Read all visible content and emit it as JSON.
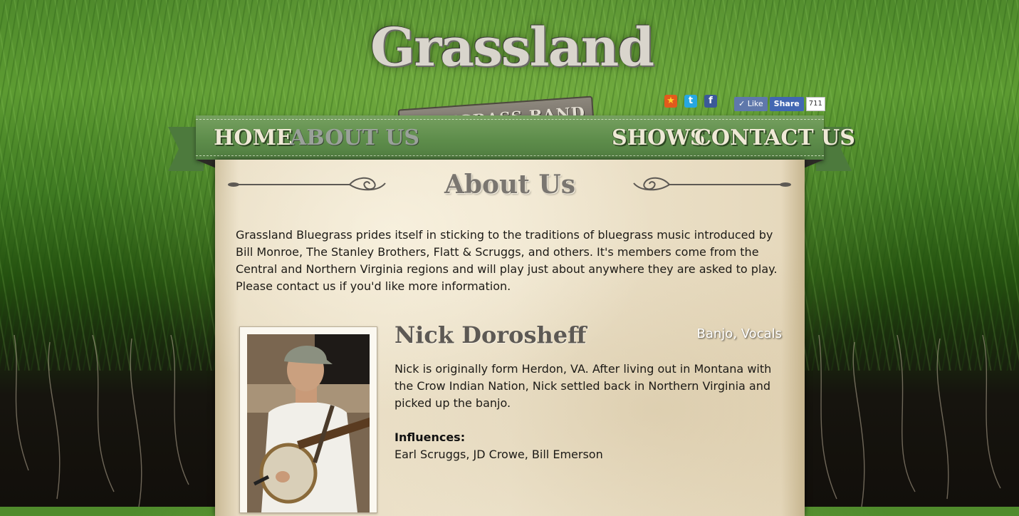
{
  "header": {
    "logo_title": "Grassland",
    "logo_subtitle": "BLUEGRASS BAND"
  },
  "social": {
    "icons": [
      "star-icon",
      "twitter-icon",
      "facebook-icon"
    ],
    "like_label": "Like",
    "share_label": "Share",
    "share_count": "711"
  },
  "nav": {
    "home": "HOME",
    "about": "ABOUT US",
    "shows": "SHOWS",
    "contact": "CONTACT US",
    "active": "about"
  },
  "page": {
    "title": "About Us",
    "intro": "Grassland Bluegrass prides itself in sticking to the traditions of bluegrass music introduced by Bill Monroe, The Stanley Brothers, Flatt & Scruggs, and others. It's members come from the Central and Northern Virginia regions and will play just about anywhere they are asked to play. Please contact us if you'd like more information."
  },
  "member": {
    "name": "Nick Dorosheff",
    "role": "Banjo, Vocals",
    "bio": "Nick is originally form Herdon, VA. After living out in Montana with the Crow Indian Nation, Nick settled back in Northern Virginia and picked up the banjo.",
    "influences_label": "Influences:",
    "influences": "Earl Scruggs, JD Crowe, Bill Emerson"
  },
  "colors": {
    "ribbon_green": "#5e8d4b",
    "paper": "#eee4cd",
    "nav_text": "#efe9d6"
  }
}
